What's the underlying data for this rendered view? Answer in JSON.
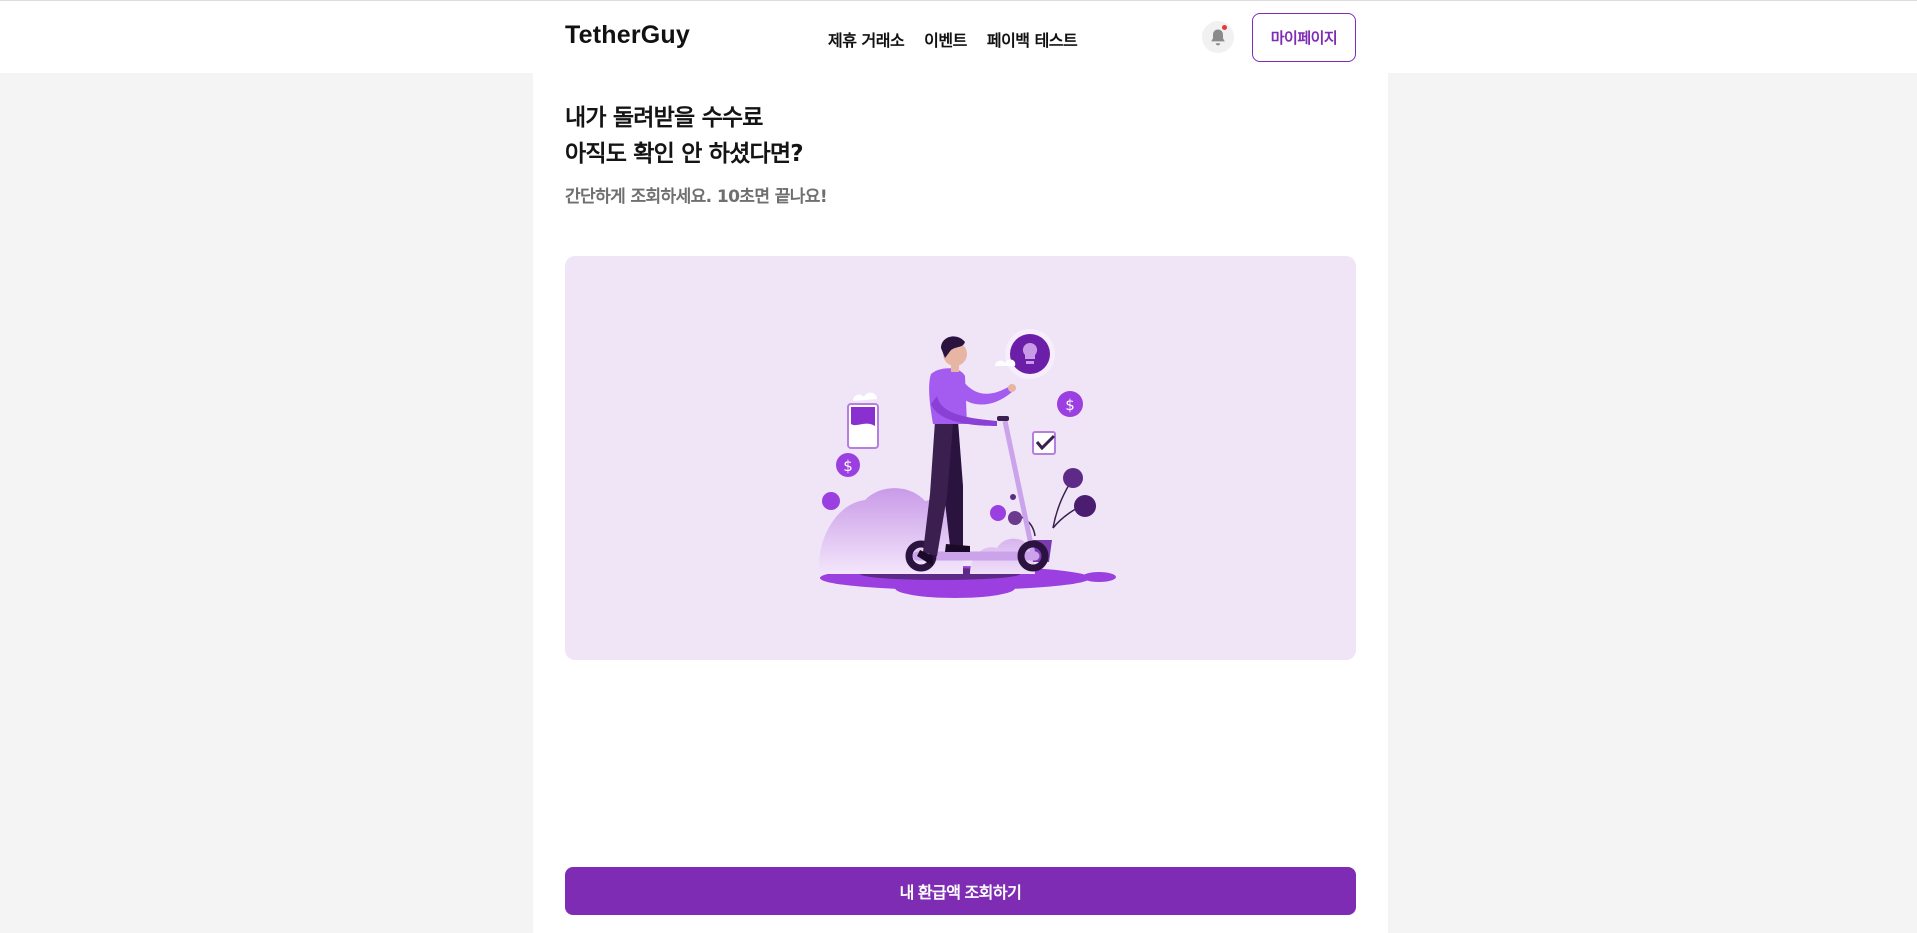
{
  "header": {
    "logo": "TetherGuy",
    "nav": [
      "제휴 거래소",
      "이벤트",
      "페이백 테스트"
    ],
    "mypage_label": "마이페이지"
  },
  "main": {
    "headline_lines": [
      "내가 돌려받을 수수료",
      "아직도 확인 안 하셨다면?"
    ],
    "subline": "간단하게 조회하세요. 10초면 끝나요!",
    "cta_label": "내 환급액 조회하기"
  },
  "icons": {
    "notification": "bell-icon",
    "illustration": "person-on-scooter-illustration"
  },
  "colors": {
    "accent": "#7f2cb4",
    "hero_bg": "#f0e5f7",
    "page_bg": "#f4f4f4",
    "notification_dot": "#e5393a"
  }
}
